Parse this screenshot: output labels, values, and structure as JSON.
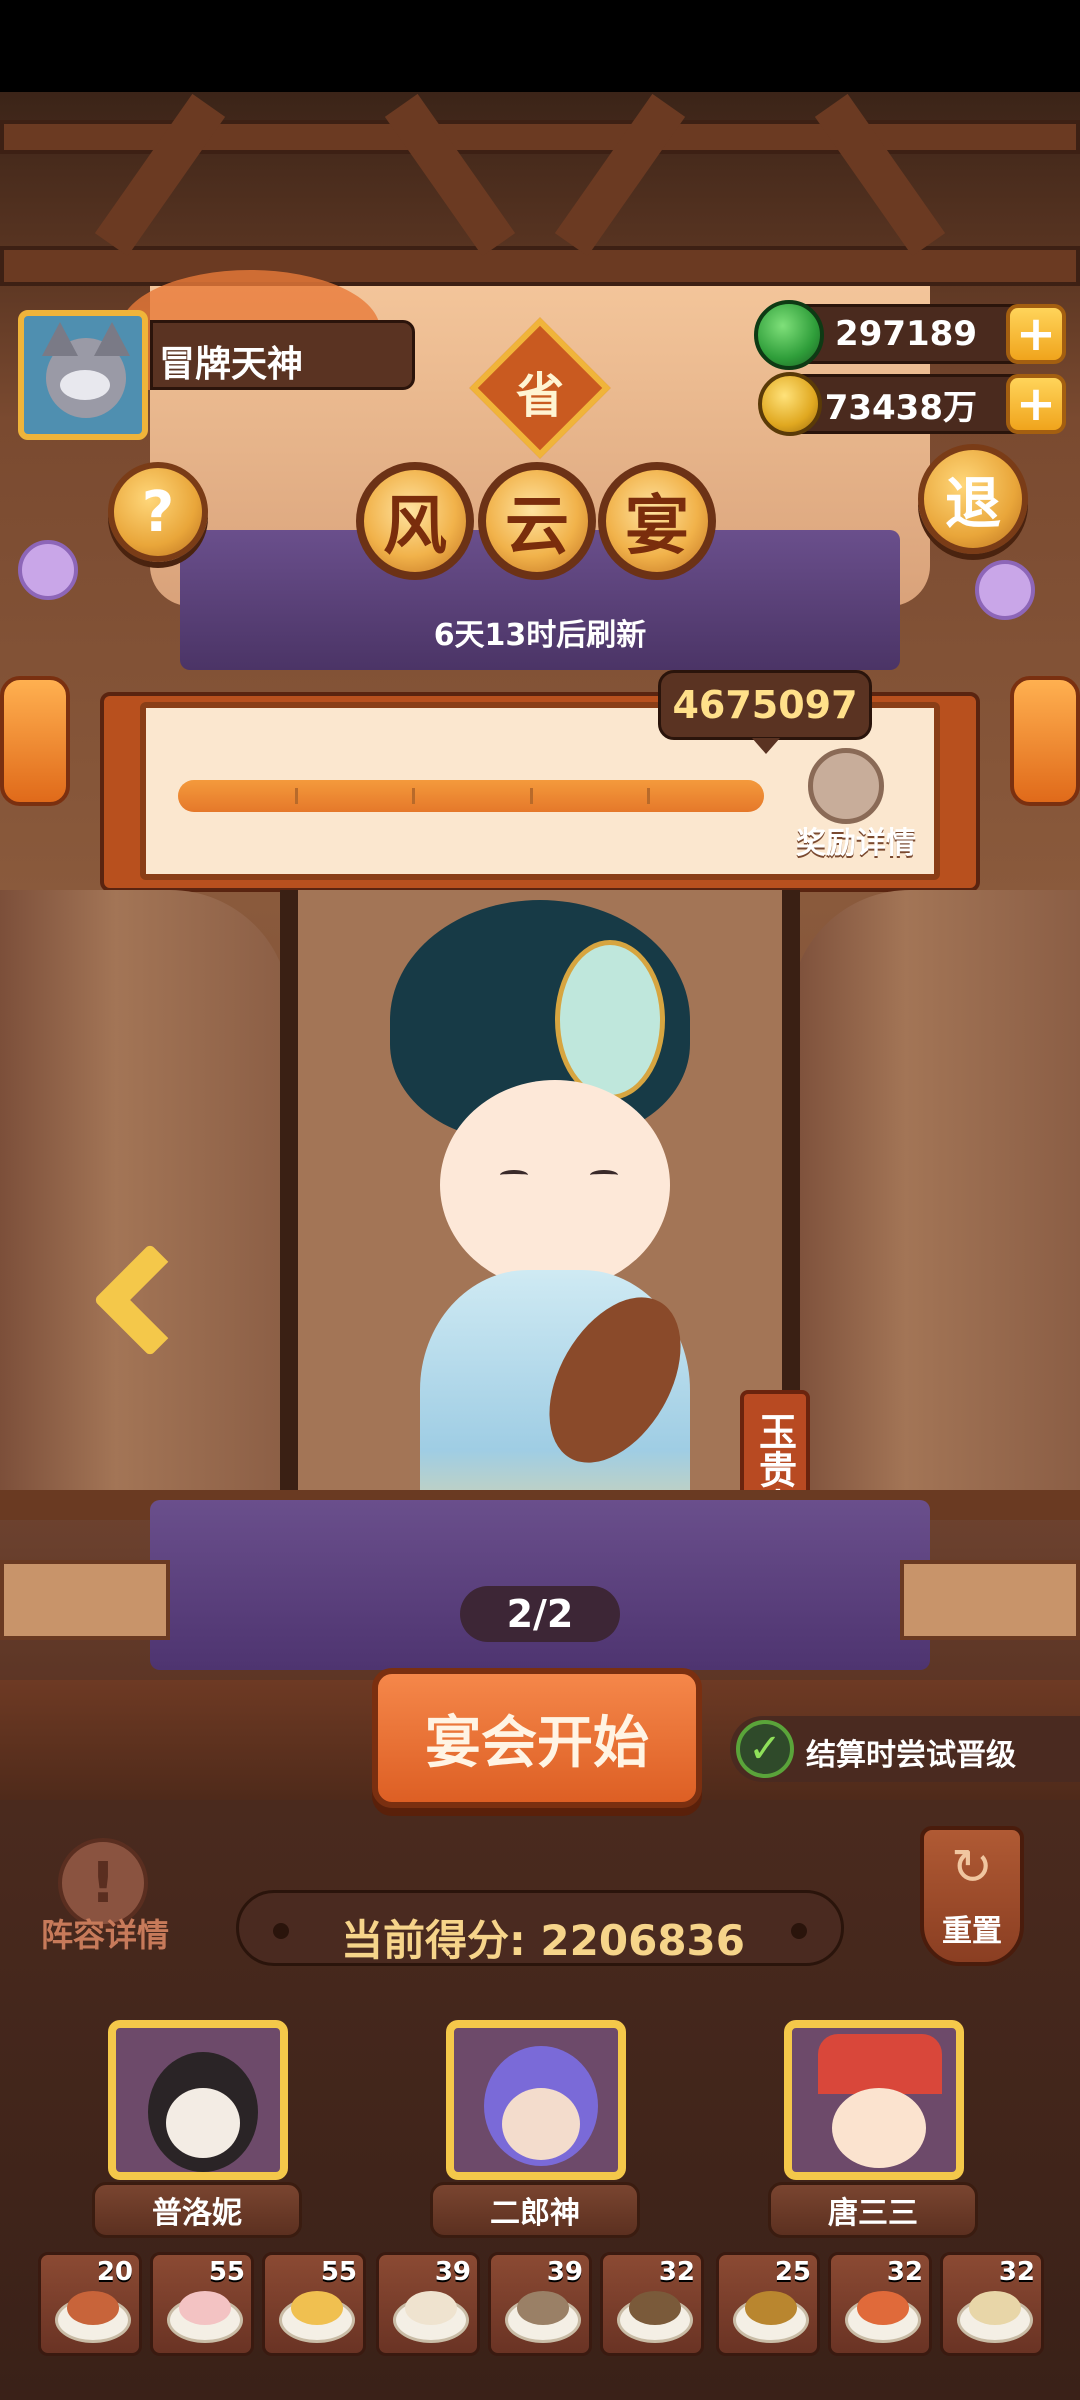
{
  "player": {
    "name": "冒牌天神"
  },
  "badge": {
    "label": "省"
  },
  "title_chars": [
    "风",
    "云",
    "宴"
  ],
  "refresh_text": "6天13时后刷新",
  "resources": {
    "jade": "297189",
    "coins": "73438万",
    "plus": "+"
  },
  "buttons": {
    "help": "?",
    "exit": "退",
    "reward_details": "奖励详情",
    "start": "宴会开始",
    "lineup_details": "阵容详情",
    "reset": "重置"
  },
  "progress": {
    "score_target": "4675097",
    "fill_fraction": 1.0,
    "tick_count": 4
  },
  "character": {
    "name": "玉贵人",
    "page": "2/2"
  },
  "auto_upgrade": {
    "label": "结算时尝试晋级",
    "checked": true
  },
  "current_score": {
    "label": "当前得分:",
    "value": "2206836"
  },
  "team": [
    {
      "name": "普洛妮"
    },
    {
      "name": "二郎神"
    },
    {
      "name": "唐三三"
    }
  ],
  "dishes": [
    {
      "count": "20",
      "color": "#c8643a"
    },
    {
      "count": "55",
      "color": "#f3c3c3"
    },
    {
      "count": "55",
      "color": "#f0c050"
    },
    {
      "count": "39",
      "color": "#efe3cf"
    },
    {
      "count": "39",
      "color": "#9a8066"
    },
    {
      "count": "32",
      "color": "#7a5a3a"
    },
    {
      "count": "25",
      "color": "#b9862f"
    },
    {
      "count": "32",
      "color": "#e06a3a"
    },
    {
      "count": "32",
      "color": "#e8d6a8"
    }
  ],
  "colors": {
    "accent": "#e5782a",
    "gold": "#f4c84a",
    "panel": "#fbe7cf"
  }
}
